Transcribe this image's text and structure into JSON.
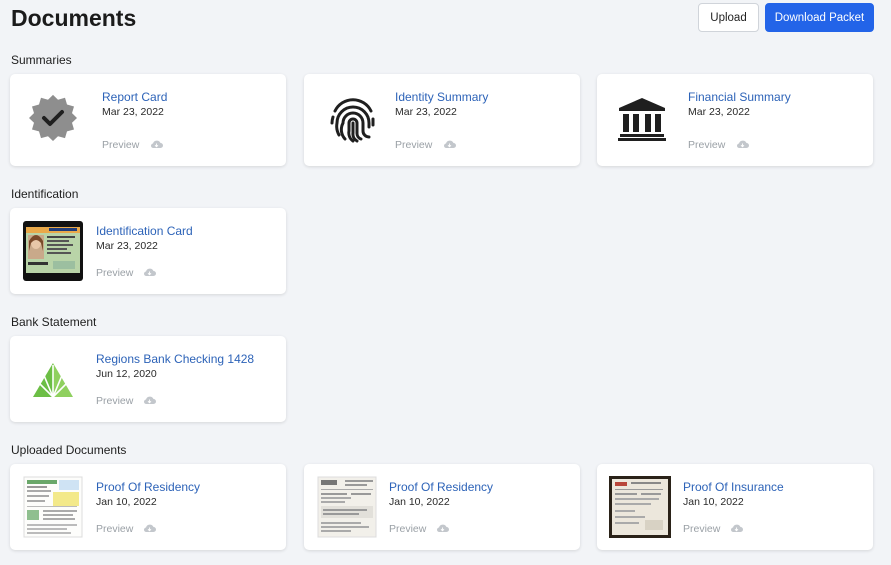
{
  "header": {
    "title": "Documents",
    "upload_label": "Upload",
    "download_label": "Download Packet"
  },
  "sections": [
    {
      "label": "Summaries",
      "cards": [
        {
          "title": "Report Card",
          "date": "Mar 23, 2022",
          "preview": "Preview",
          "icon": "badge-check-icon"
        },
        {
          "title": "Identity Summary",
          "date": "Mar 23, 2022",
          "preview": "Preview",
          "icon": "fingerprint-icon"
        },
        {
          "title": "Financial Summary",
          "date": "Mar 23, 2022",
          "preview": "Preview",
          "icon": "bank-icon"
        }
      ]
    },
    {
      "label": "Identification",
      "cards": [
        {
          "title": "Identification Card",
          "date": "Mar 23, 2022",
          "preview": "Preview",
          "icon": "id-card-thumbnail"
        }
      ]
    },
    {
      "label": "Bank Statement",
      "cards": [
        {
          "title": "Regions Bank Checking 1428",
          "date": "Jun 12, 2020",
          "preview": "Preview",
          "icon": "regions-bank-logo"
        }
      ]
    },
    {
      "label": "Uploaded Documents",
      "cards": [
        {
          "title": "Proof Of Residency",
          "date": "Jan 10, 2022",
          "preview": "Preview",
          "icon": "document-thumbnail"
        },
        {
          "title": "Proof Of Residency",
          "date": "Jan 10, 2022",
          "preview": "Preview",
          "icon": "document-thumbnail"
        },
        {
          "title": "Proof Of Insurance",
          "date": "Jan 10, 2022",
          "preview": "Preview",
          "icon": "document-thumbnail"
        }
      ]
    }
  ],
  "colors": {
    "accent": "#2364e8",
    "link": "#2d63b8",
    "background": "#f2f4f7",
    "bank_green": "#6cbe45"
  }
}
